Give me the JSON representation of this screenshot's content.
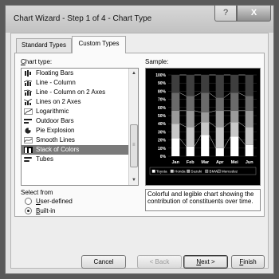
{
  "window": {
    "title": "Chart Wizard - Step 1 of 4 - Chart Type",
    "help_label": "?",
    "close_label": "X"
  },
  "tabs": [
    {
      "label": "Standard Types",
      "active": false
    },
    {
      "label": "Custom Types",
      "active": true
    }
  ],
  "chart_type": {
    "label": "Chart type:",
    "items": [
      {
        "label": "Floating Bars",
        "icon": "floating-bars-icon"
      },
      {
        "label": "Line - Column",
        "icon": "line-column-icon"
      },
      {
        "label": "Line - Column on 2 Axes",
        "icon": "line-column-2-axes-icon"
      },
      {
        "label": "Lines on 2 Axes",
        "icon": "lines-2-axes-icon"
      },
      {
        "label": "Logarithmic",
        "icon": "logarithmic-icon"
      },
      {
        "label": "Outdoor Bars",
        "icon": "outdoor-bars-icon"
      },
      {
        "label": "Pie Explosion",
        "icon": "pie-explosion-icon"
      },
      {
        "label": "Smooth Lines",
        "icon": "smooth-lines-icon"
      },
      {
        "label": "Stack of Colors",
        "icon": "stack-of-colors-icon",
        "selected": true
      },
      {
        "label": "Tubes",
        "icon": "tubes-icon"
      }
    ]
  },
  "sample": {
    "label": "Sample:",
    "chart_data": {
      "type": "bar",
      "stacked": "percent",
      "categories": [
        "Jan",
        "Feb",
        "Mar",
        "Apr",
        "Mei",
        "Jun"
      ],
      "yticks": [
        "0%",
        "10%",
        "20%",
        "30%",
        "40%",
        "50%",
        "60%",
        "70%",
        "80%",
        "90%",
        "100%"
      ],
      "ylim": [
        0,
        100
      ],
      "legend_position": "bottom",
      "series": [
        {
          "name": "Toyota",
          "color": "#ffffff",
          "values": [
            22,
            12,
            26,
            10,
            24,
            14
          ]
        },
        {
          "name": "Honda",
          "color": "#c8c8c8",
          "values": [
            18,
            24,
            16,
            26,
            18,
            22
          ]
        },
        {
          "name": "Suzuki",
          "color": "#9a9a9a",
          "values": [
            16,
            20,
            12,
            20,
            14,
            20
          ]
        },
        {
          "name": "BMW",
          "color": "#6a6a6a",
          "values": [
            22,
            18,
            24,
            16,
            22,
            18
          ]
        },
        {
          "name": "Mercedez",
          "color": "#3e3e3e",
          "values": [
            22,
            26,
            22,
            28,
            22,
            26
          ]
        }
      ]
    }
  },
  "select_from": {
    "label": "Select from",
    "options": [
      {
        "label": "User-defined",
        "accel": "U",
        "rest": "ser-defined",
        "checked": false
      },
      {
        "label": "Built-in",
        "accel": "B",
        "rest": "uilt-in",
        "checked": true
      }
    ]
  },
  "description": "Colorful and legible chart showing the contribution of constituents over time.",
  "buttons": {
    "cancel": "Cancel",
    "back": "< Back",
    "next": "Next >",
    "finish": "Finish"
  }
}
